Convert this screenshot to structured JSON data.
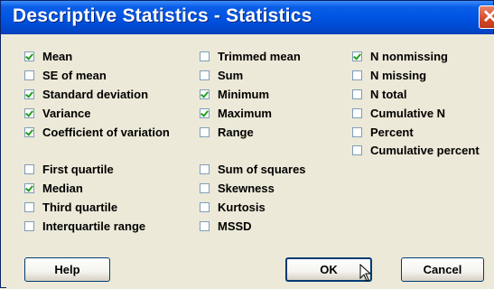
{
  "window": {
    "title": "Descriptive Statistics - Statistics"
  },
  "columns": {
    "left": [
      {
        "label": "Mean",
        "checked": true
      },
      {
        "label": "SE of mean",
        "checked": false
      },
      {
        "label": "Standard deviation",
        "checked": true
      },
      {
        "label": "Variance",
        "checked": true
      },
      {
        "label": "Coefficient of variation",
        "checked": true
      },
      {
        "label": "First quartile",
        "checked": false
      },
      {
        "label": "Median",
        "checked": true
      },
      {
        "label": "Third quartile",
        "checked": false
      },
      {
        "label": "Interquartile range",
        "checked": false
      }
    ],
    "middle": [
      {
        "label": "Trimmed mean",
        "checked": false
      },
      {
        "label": "Sum",
        "checked": false
      },
      {
        "label": "Minimum",
        "checked": true
      },
      {
        "label": "Maximum",
        "checked": true
      },
      {
        "label": "Range",
        "checked": false
      },
      {
        "label": "Sum of squares",
        "checked": false
      },
      {
        "label": "Skewness",
        "checked": false
      },
      {
        "label": "Kurtosis",
        "checked": false
      },
      {
        "label": "MSSD",
        "checked": false
      }
    ],
    "right": [
      {
        "label": "N nonmissing",
        "checked": true
      },
      {
        "label": "N missing",
        "checked": false
      },
      {
        "label": "N total",
        "checked": false
      },
      {
        "label": "Cumulative N",
        "checked": false
      },
      {
        "label": "Percent",
        "checked": false
      },
      {
        "label": "Cumulative percent",
        "checked": false
      }
    ]
  },
  "buttons": {
    "help": "Help",
    "ok": "OK",
    "cancel": "Cancel"
  }
}
